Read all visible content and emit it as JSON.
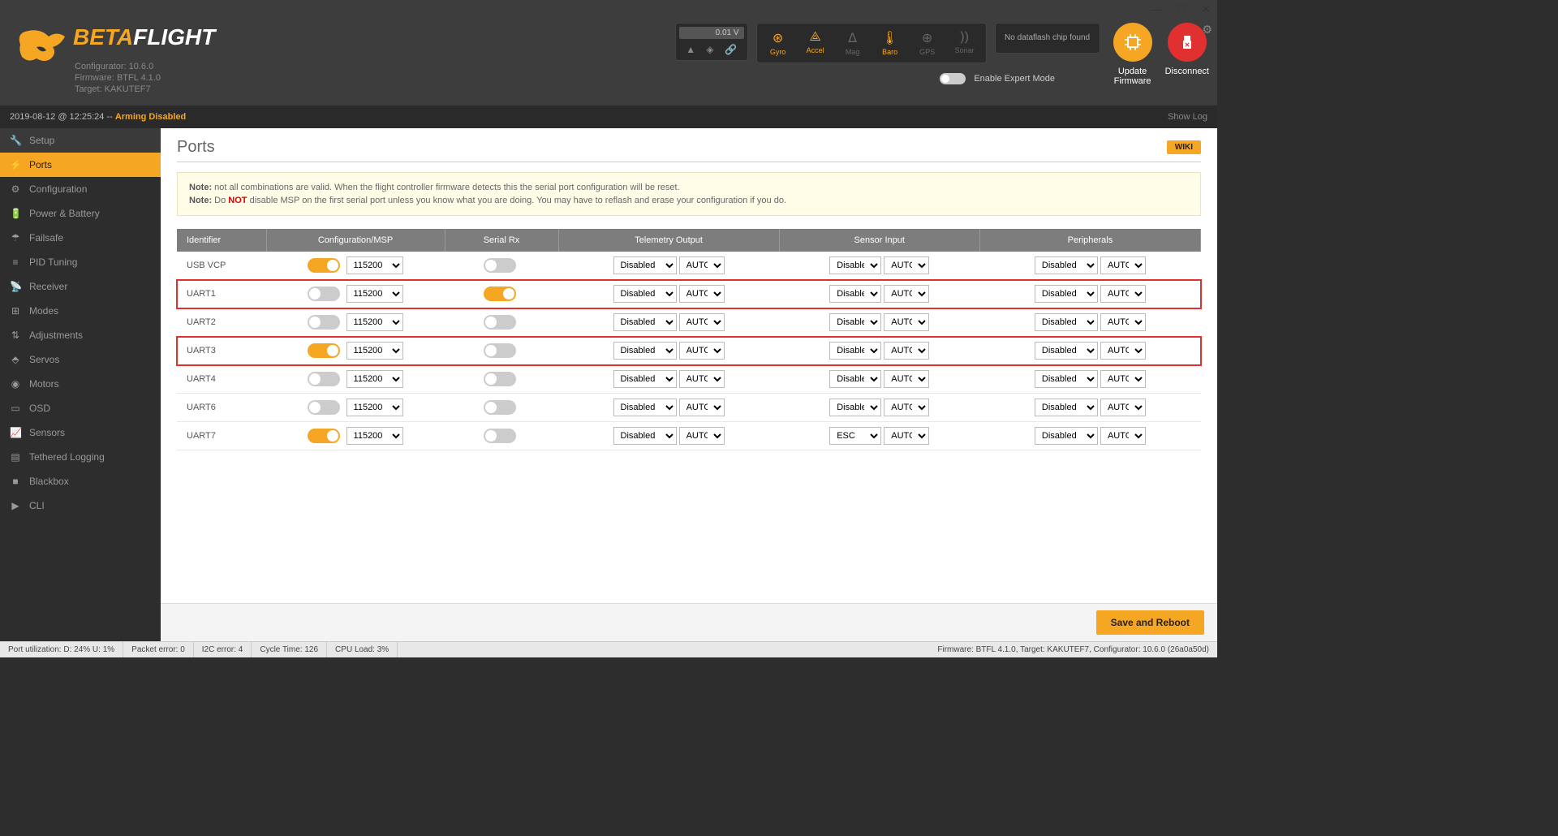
{
  "window": {
    "minimize": "—",
    "maximize": "□",
    "close": "✕"
  },
  "logo": {
    "beta": "BETA",
    "flight": "FLIGHT"
  },
  "version_info": {
    "configurator": "Configurator: 10.6.0",
    "firmware": "Firmware: BTFL 4.1.0",
    "target": "Target: KAKUTEF7"
  },
  "header": {
    "voltage": "0.01 V",
    "dataflash": "No dataflash chip found",
    "expert_label": "Enable Expert Mode",
    "update_firmware": "Update Firmware",
    "disconnect": "Disconnect",
    "sensors": [
      {
        "name": "Gyro",
        "active": true
      },
      {
        "name": "Accel",
        "active": true
      },
      {
        "name": "Mag",
        "active": false
      },
      {
        "name": "Baro",
        "active": true
      },
      {
        "name": "GPS",
        "active": false
      },
      {
        "name": "Sonar",
        "active": false
      }
    ]
  },
  "status_bar": {
    "timestamp": "2019-08-12 @ 12:25:24 -- ",
    "arming": "Arming Disabled",
    "showlog": "Show Log"
  },
  "sidebar": [
    {
      "label": "Setup",
      "icon": "wrench"
    },
    {
      "label": "Ports",
      "icon": "plug",
      "active": true
    },
    {
      "label": "Configuration",
      "icon": "gear"
    },
    {
      "label": "Power & Battery",
      "icon": "battery"
    },
    {
      "label": "Failsafe",
      "icon": "parachute"
    },
    {
      "label": "PID Tuning",
      "icon": "sliders"
    },
    {
      "label": "Receiver",
      "icon": "antenna"
    },
    {
      "label": "Modes",
      "icon": "switches"
    },
    {
      "label": "Adjustments",
      "icon": "adjust"
    },
    {
      "label": "Servos",
      "icon": "servo"
    },
    {
      "label": "Motors",
      "icon": "motor"
    },
    {
      "label": "OSD",
      "icon": "osd"
    },
    {
      "label": "Sensors",
      "icon": "chart"
    },
    {
      "label": "Tethered Logging",
      "icon": "log"
    },
    {
      "label": "Blackbox",
      "icon": "blackbox"
    },
    {
      "label": "CLI",
      "icon": "cli"
    }
  ],
  "page": {
    "title": "Ports",
    "wiki": "WIKI",
    "note1_label": "Note:",
    "note1_text": " not all combinations are valid. When the flight controller firmware detects this the serial port configuration will be reset.",
    "note2_label": "Note:",
    "note2_pre": " Do ",
    "note2_not": "NOT",
    "note2_post": " disable MSP on the first serial port unless you know what you are doing. You may have to reflash and erase your configuration if you do.",
    "save_reboot": "Save and Reboot"
  },
  "table": {
    "headers": [
      "Identifier",
      "Configuration/MSP",
      "Serial Rx",
      "Telemetry Output",
      "Sensor Input",
      "Peripherals"
    ],
    "rows": [
      {
        "id": "USB VCP",
        "msp_on": true,
        "msp_baud": "115200",
        "rx_on": false,
        "telem": "Disabled",
        "telem_baud": "AUTO",
        "sensor": "Disabled",
        "sensor_baud": "AUTO",
        "periph": "Disabled",
        "periph_baud": "AUTO",
        "hl": false
      },
      {
        "id": "UART1",
        "msp_on": false,
        "msp_baud": "115200",
        "rx_on": true,
        "telem": "Disabled",
        "telem_baud": "AUTO",
        "sensor": "Disabled",
        "sensor_baud": "AUTO",
        "periph": "Disabled",
        "periph_baud": "AUTO",
        "hl": true
      },
      {
        "id": "UART2",
        "msp_on": false,
        "msp_baud": "115200",
        "rx_on": false,
        "telem": "Disabled",
        "telem_baud": "AUTO",
        "sensor": "Disabled",
        "sensor_baud": "AUTO",
        "periph": "Disabled",
        "periph_baud": "AUTO",
        "hl": false
      },
      {
        "id": "UART3",
        "msp_on": true,
        "msp_baud": "115200",
        "rx_on": false,
        "telem": "Disabled",
        "telem_baud": "AUTO",
        "sensor": "Disabled",
        "sensor_baud": "AUTO",
        "periph": "Disabled",
        "periph_baud": "AUTO",
        "hl": true
      },
      {
        "id": "UART4",
        "msp_on": false,
        "msp_baud": "115200",
        "rx_on": false,
        "telem": "Disabled",
        "telem_baud": "AUTO",
        "sensor": "Disabled",
        "sensor_baud": "AUTO",
        "periph": "Disabled",
        "periph_baud": "AUTO",
        "hl": false
      },
      {
        "id": "UART6",
        "msp_on": false,
        "msp_baud": "115200",
        "rx_on": false,
        "telem": "Disabled",
        "telem_baud": "AUTO",
        "sensor": "Disabled",
        "sensor_baud": "AUTO",
        "periph": "Disabled",
        "periph_baud": "AUTO",
        "hl": false
      },
      {
        "id": "UART7",
        "msp_on": true,
        "msp_baud": "115200",
        "rx_on": false,
        "telem": "Disabled",
        "telem_baud": "AUTO",
        "sensor": "ESC",
        "sensor_baud": "AUTO",
        "periph": "Disabled",
        "periph_baud": "AUTO",
        "hl": false
      }
    ]
  },
  "footer": {
    "port_util": "Port utilization: D: 24% U: 1%",
    "packet_err": "Packet error: 0",
    "i2c_err": "I2C error: 4",
    "cycle": "Cycle Time: 126",
    "cpu": "CPU Load: 3%",
    "right": "Firmware: BTFL 4.1.0, Target: KAKUTEF7, Configurator: 10.6.0 (26a0a50d)"
  }
}
